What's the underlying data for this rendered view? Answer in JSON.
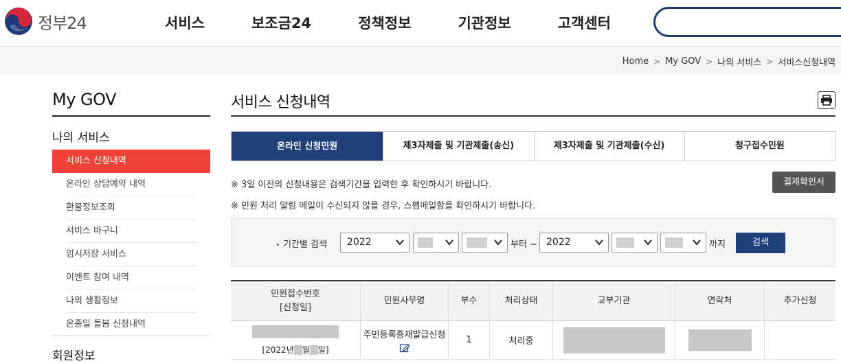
{
  "header": {
    "logo_text": "정부24",
    "nav": [
      "서비스",
      "보조금24",
      "정책정보",
      "기관정보",
      "고객센터"
    ],
    "search_placeholder": ""
  },
  "breadcrumb": [
    "Home",
    "My GOV",
    "나의 서비스",
    "서비스신청내역"
  ],
  "sidebar": {
    "title": "My GOV",
    "section": "나의 서비스",
    "items": [
      {
        "label": "서비스 신청내역",
        "active": true
      },
      {
        "label": "온라인 상담예약 내역"
      },
      {
        "label": "환불정보조회"
      },
      {
        "label": "서비스 바구니"
      },
      {
        "label": "임시저장 서비스"
      },
      {
        "label": "이벤트 참여 내역"
      },
      {
        "label": "나의 생활정보"
      },
      {
        "label": "온종일 돌봄 신청내역"
      }
    ],
    "section2": "회원정보"
  },
  "main": {
    "title": "서비스 신청내역",
    "tabs": [
      "온라인 신청민원",
      "제3자제출 및 기관제출(송신)",
      "제3자제출 및 기관제출(수신)",
      "청구접수민원"
    ],
    "notice1": "※ 3일 이전의 신청내용은 검색기간을 입력한 후 확인하시기 바랍니다.",
    "notice2": "※ 민원 처리 알림 메일이 수신되지 않을 경우, 스팸메일함을 확인하시기 바랍니다.",
    "pay_button": "결제확인서",
    "search": {
      "label": "기간별 검색",
      "from_year": "2022",
      "from_text": "부터 ~",
      "to_year": "2022",
      "to_text": "까지",
      "button": "검색"
    },
    "table": {
      "headers": [
        "민원접수번호\n[신청일]",
        "민원사무명",
        "부수",
        "처리상태",
        "교부기관",
        "연락처",
        "추가신청"
      ],
      "header_line1": "민원접수번호",
      "header_line2": "[신청일]",
      "rows": [
        {
          "date_prefix": "[2022년",
          "date_mid": "월",
          "date_suffix": "일]",
          "service": "주민등록증재발급신청",
          "copies": "1",
          "status": "처리중"
        }
      ]
    }
  },
  "colors": {
    "brand_blue": "#1f3f7a",
    "active_red": "#ef4135",
    "pay_button": "#555555"
  }
}
